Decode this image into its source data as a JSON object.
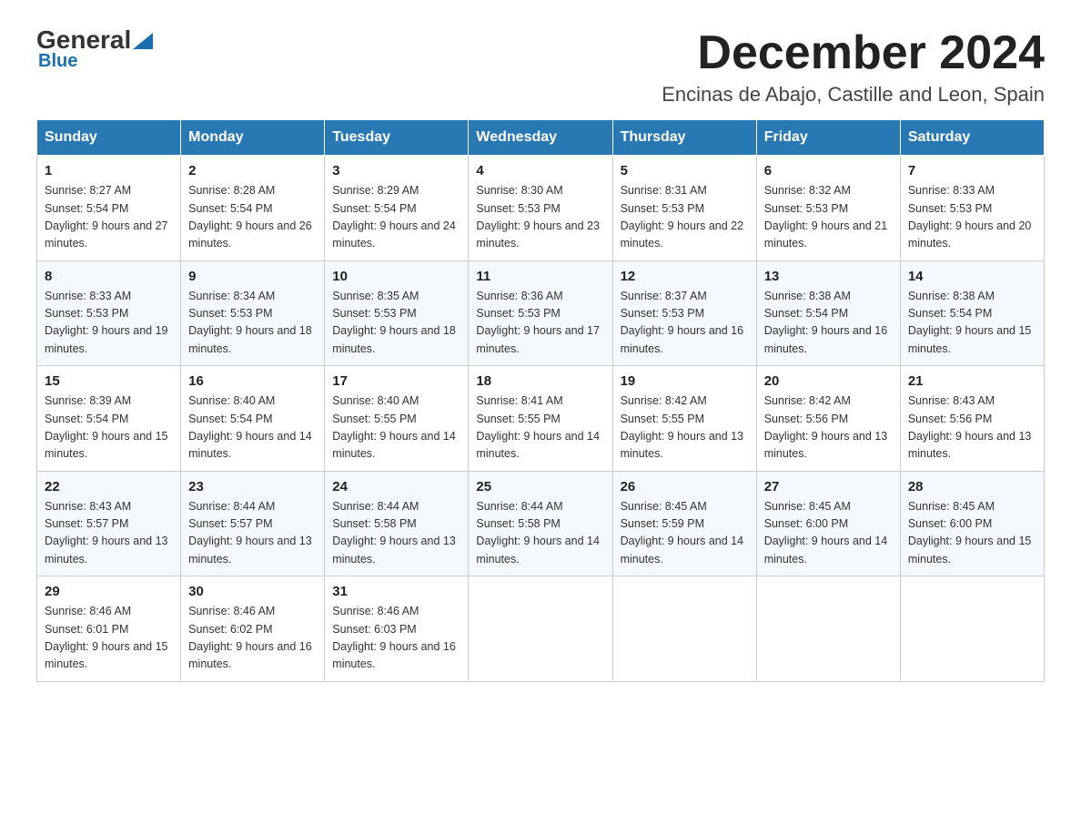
{
  "header": {
    "logo_general": "General",
    "logo_blue": "Blue",
    "month_title": "December 2024",
    "location": "Encinas de Abajo, Castille and Leon, Spain"
  },
  "weekdays": [
    "Sunday",
    "Monday",
    "Tuesday",
    "Wednesday",
    "Thursday",
    "Friday",
    "Saturday"
  ],
  "weeks": [
    [
      {
        "day": "1",
        "sunrise": "8:27 AM",
        "sunset": "5:54 PM",
        "daylight": "9 hours and 27 minutes."
      },
      {
        "day": "2",
        "sunrise": "8:28 AM",
        "sunset": "5:54 PM",
        "daylight": "9 hours and 26 minutes."
      },
      {
        "day": "3",
        "sunrise": "8:29 AM",
        "sunset": "5:54 PM",
        "daylight": "9 hours and 24 minutes."
      },
      {
        "day": "4",
        "sunrise": "8:30 AM",
        "sunset": "5:53 PM",
        "daylight": "9 hours and 23 minutes."
      },
      {
        "day": "5",
        "sunrise": "8:31 AM",
        "sunset": "5:53 PM",
        "daylight": "9 hours and 22 minutes."
      },
      {
        "day": "6",
        "sunrise": "8:32 AM",
        "sunset": "5:53 PM",
        "daylight": "9 hours and 21 minutes."
      },
      {
        "day": "7",
        "sunrise": "8:33 AM",
        "sunset": "5:53 PM",
        "daylight": "9 hours and 20 minutes."
      }
    ],
    [
      {
        "day": "8",
        "sunrise": "8:33 AM",
        "sunset": "5:53 PM",
        "daylight": "9 hours and 19 minutes."
      },
      {
        "day": "9",
        "sunrise": "8:34 AM",
        "sunset": "5:53 PM",
        "daylight": "9 hours and 18 minutes."
      },
      {
        "day": "10",
        "sunrise": "8:35 AM",
        "sunset": "5:53 PM",
        "daylight": "9 hours and 18 minutes."
      },
      {
        "day": "11",
        "sunrise": "8:36 AM",
        "sunset": "5:53 PM",
        "daylight": "9 hours and 17 minutes."
      },
      {
        "day": "12",
        "sunrise": "8:37 AM",
        "sunset": "5:53 PM",
        "daylight": "9 hours and 16 minutes."
      },
      {
        "day": "13",
        "sunrise": "8:38 AM",
        "sunset": "5:54 PM",
        "daylight": "9 hours and 16 minutes."
      },
      {
        "day": "14",
        "sunrise": "8:38 AM",
        "sunset": "5:54 PM",
        "daylight": "9 hours and 15 minutes."
      }
    ],
    [
      {
        "day": "15",
        "sunrise": "8:39 AM",
        "sunset": "5:54 PM",
        "daylight": "9 hours and 15 minutes."
      },
      {
        "day": "16",
        "sunrise": "8:40 AM",
        "sunset": "5:54 PM",
        "daylight": "9 hours and 14 minutes."
      },
      {
        "day": "17",
        "sunrise": "8:40 AM",
        "sunset": "5:55 PM",
        "daylight": "9 hours and 14 minutes."
      },
      {
        "day": "18",
        "sunrise": "8:41 AM",
        "sunset": "5:55 PM",
        "daylight": "9 hours and 14 minutes."
      },
      {
        "day": "19",
        "sunrise": "8:42 AM",
        "sunset": "5:55 PM",
        "daylight": "9 hours and 13 minutes."
      },
      {
        "day": "20",
        "sunrise": "8:42 AM",
        "sunset": "5:56 PM",
        "daylight": "9 hours and 13 minutes."
      },
      {
        "day": "21",
        "sunrise": "8:43 AM",
        "sunset": "5:56 PM",
        "daylight": "9 hours and 13 minutes."
      }
    ],
    [
      {
        "day": "22",
        "sunrise": "8:43 AM",
        "sunset": "5:57 PM",
        "daylight": "9 hours and 13 minutes."
      },
      {
        "day": "23",
        "sunrise": "8:44 AM",
        "sunset": "5:57 PM",
        "daylight": "9 hours and 13 minutes."
      },
      {
        "day": "24",
        "sunrise": "8:44 AM",
        "sunset": "5:58 PM",
        "daylight": "9 hours and 13 minutes."
      },
      {
        "day": "25",
        "sunrise": "8:44 AM",
        "sunset": "5:58 PM",
        "daylight": "9 hours and 14 minutes."
      },
      {
        "day": "26",
        "sunrise": "8:45 AM",
        "sunset": "5:59 PM",
        "daylight": "9 hours and 14 minutes."
      },
      {
        "day": "27",
        "sunrise": "8:45 AM",
        "sunset": "6:00 PM",
        "daylight": "9 hours and 14 minutes."
      },
      {
        "day": "28",
        "sunrise": "8:45 AM",
        "sunset": "6:00 PM",
        "daylight": "9 hours and 15 minutes."
      }
    ],
    [
      {
        "day": "29",
        "sunrise": "8:46 AM",
        "sunset": "6:01 PM",
        "daylight": "9 hours and 15 minutes."
      },
      {
        "day": "30",
        "sunrise": "8:46 AM",
        "sunset": "6:02 PM",
        "daylight": "9 hours and 16 minutes."
      },
      {
        "day": "31",
        "sunrise": "8:46 AM",
        "sunset": "6:03 PM",
        "daylight": "9 hours and 16 minutes."
      },
      null,
      null,
      null,
      null
    ]
  ]
}
